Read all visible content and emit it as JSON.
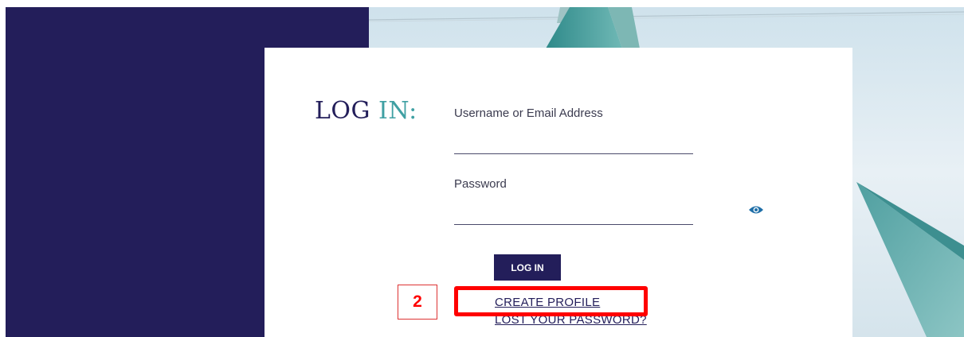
{
  "login": {
    "title_part1": "LOG ",
    "title_part2": "IN:",
    "username_label": "Username or Email Address",
    "username_value": "",
    "password_label": "Password",
    "password_value": "",
    "show_password_icon": "eye-icon",
    "submit_label": "LOG IN",
    "create_profile_label": "CREATE PROFILE",
    "lost_password_label": "LOST YOUR PASSWORD?"
  },
  "annotation": {
    "number": "2"
  },
  "colors": {
    "navy": "#231e5a",
    "teal_accent": "#3fa0a3",
    "annotation_red": "#ff0000"
  }
}
